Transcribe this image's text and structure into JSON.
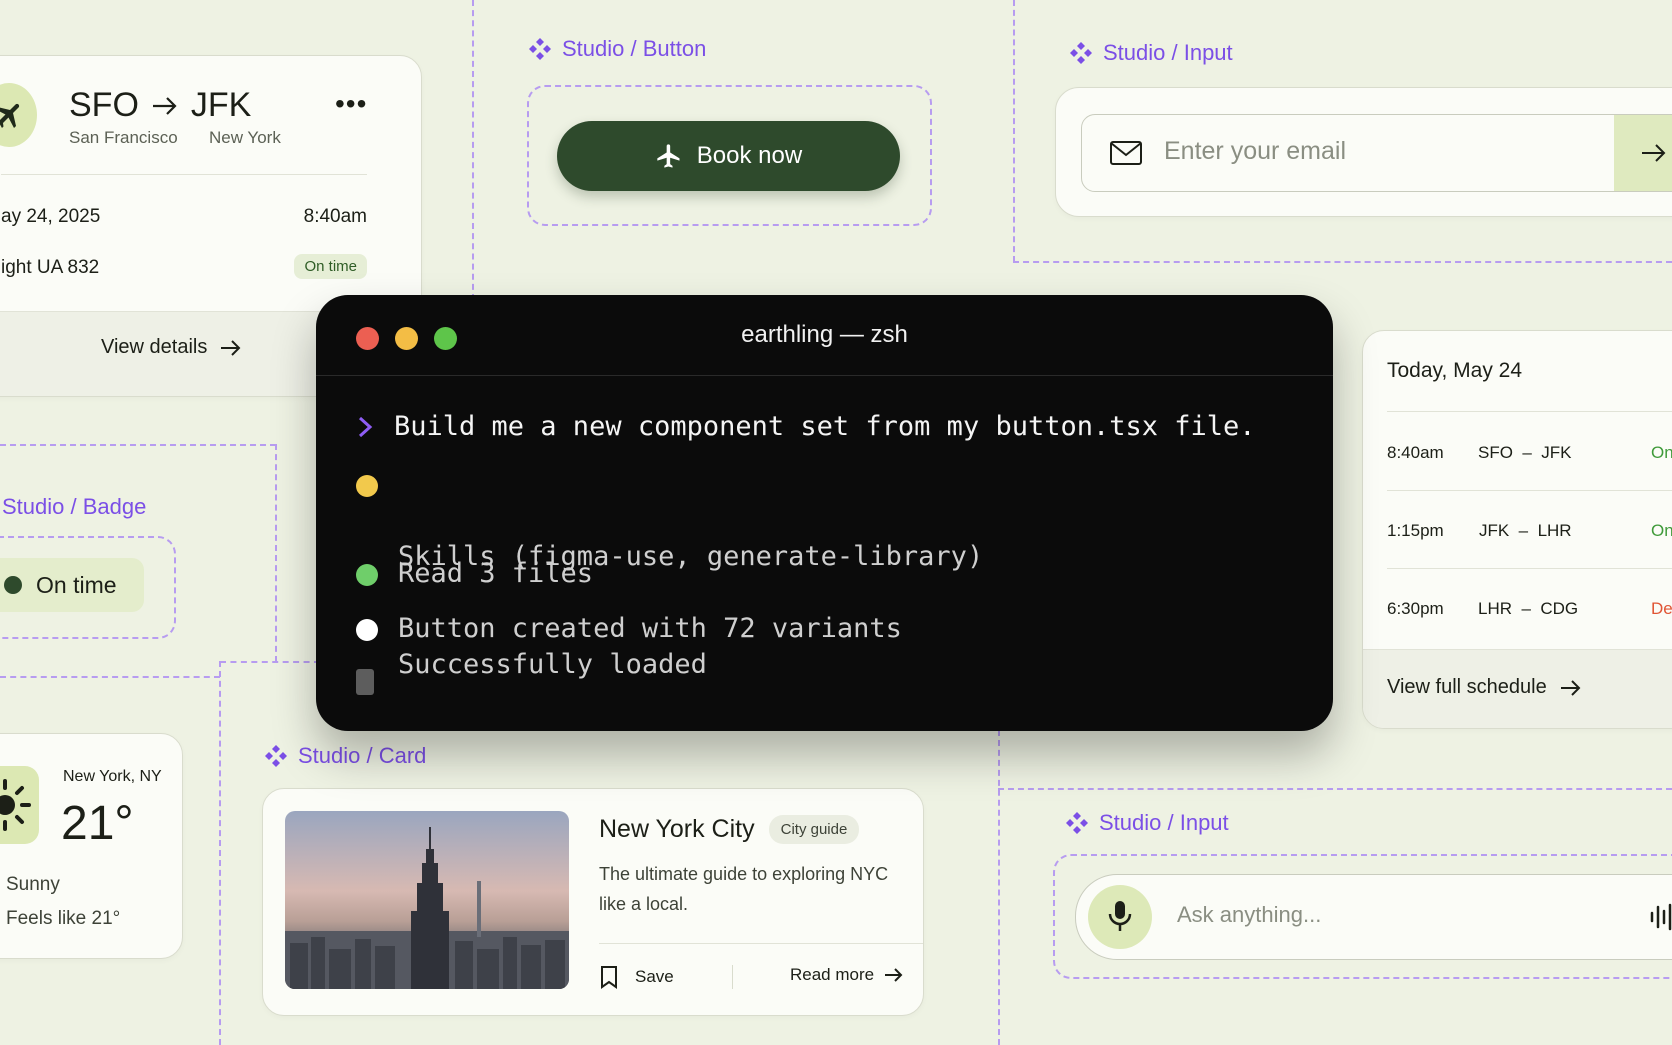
{
  "studio_labels": {
    "button": "Studio / Button",
    "input_top": "Studio / Input",
    "badge": "Studio / Badge",
    "card": "Studio / Card",
    "input_bottom": "Studio / Input"
  },
  "flight_card": {
    "from": "SFO",
    "to": "JFK",
    "from_city": "San Francisco",
    "to_city": "New York",
    "date": "ay 24, 2025",
    "time": "8:40am",
    "flight": "ight UA 832",
    "status": "On time",
    "view_details": "View details"
  },
  "button": {
    "label": "Book now"
  },
  "email_input": {
    "placeholder": "Enter your email"
  },
  "badge": {
    "label": "On time"
  },
  "terminal": {
    "title": "earthling — zsh",
    "prompt": "Build me a new component set from my button.tsx file.",
    "lines": [
      {
        "text": "Skills (figma-use, generate-library)",
        "text2": "Successfully loaded",
        "color": "#f2c94c"
      },
      {
        "text": "Read 3 files",
        "color": "#6fce6a"
      },
      {
        "text": "Button created with 72 variants",
        "color": "#ffffff"
      }
    ]
  },
  "schedule": {
    "date": "Today, May 24",
    "rows": [
      {
        "time": "8:40am",
        "route": "SFO  –  JFK",
        "status": "On",
        "status_color": "#3f9a3a"
      },
      {
        "time": "1:15pm",
        "route": "JFK  –  LHR",
        "status": "On",
        "status_color": "#3f9a3a"
      },
      {
        "time": "6:30pm",
        "route": "LHR  –  CDG",
        "status": "De",
        "status_color": "#e05535"
      }
    ],
    "view_full": "View full schedule"
  },
  "weather": {
    "location": "New York, NY",
    "temp": "21°",
    "condition": "Sunny",
    "feels_like": "Feels like 21°"
  },
  "city_card": {
    "title": "New York City",
    "tag": "City guide",
    "description": "The ultimate guide to exploring NYC like a local.",
    "save": "Save",
    "read_more": "Read more"
  },
  "ask_input": {
    "placeholder": "Ask anything..."
  },
  "colors": {
    "accent_purple": "#7b4fe6",
    "button_green": "#2e4a2c",
    "lime": "#dde9b8"
  }
}
